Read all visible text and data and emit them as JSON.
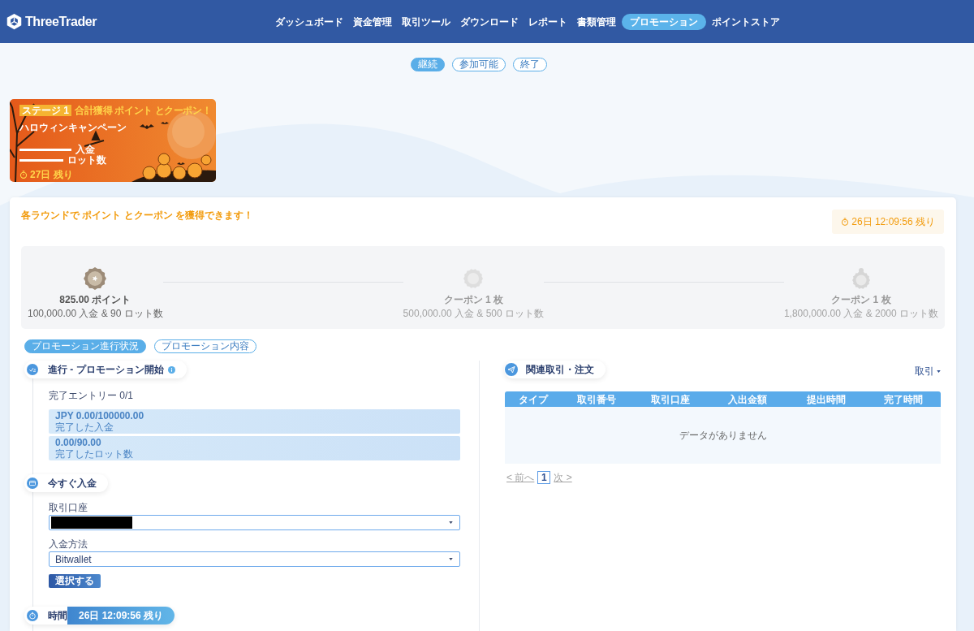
{
  "header": {
    "logo": "ThreeTrader",
    "nav": [
      {
        "label": "ダッシュボード",
        "selected": false
      },
      {
        "label": "資金管理",
        "selected": false
      },
      {
        "label": "取引ツール",
        "selected": false
      },
      {
        "label": "ダウンロード",
        "selected": false
      },
      {
        "label": "レポート",
        "selected": false
      },
      {
        "label": "書類管理",
        "selected": false
      },
      {
        "label": "プロモーション",
        "selected": true
      },
      {
        "label": "ポイントストア",
        "selected": false
      }
    ]
  },
  "status_filters": [
    {
      "label": "継続",
      "selected": true
    },
    {
      "label": "参加可能",
      "selected": false
    },
    {
      "label": "終了",
      "selected": false
    }
  ],
  "banner": {
    "stage": "ステージ 1",
    "headline": "合計獲得 ポイント とクーポン！",
    "title": "ハロウィンキャンペーン",
    "metrics": [
      "入金",
      "ロット数"
    ],
    "remaining": "27日 残り"
  },
  "promotion": {
    "intro": "各ラウンドで ポイント とクーポン を獲得できます！",
    "timer": "26日 12:09:56 残り",
    "stages": [
      {
        "kind": "seal",
        "reward": "825.00 ポイント",
        "requirement": "100,000.00 入金 & 90 ロット数",
        "active": true
      },
      {
        "kind": "coin",
        "reward": "クーポン 1 枚",
        "requirement": "500,000.00 入金 & 500 ロット数",
        "active": false
      },
      {
        "kind": "pendant",
        "reward": "クーポン 1 枚",
        "requirement": "1,800,000.00 入金 & 2000 ロット数",
        "active": false
      }
    ]
  },
  "tabs": [
    {
      "label": "プロモーション進行状況",
      "selected": true
    },
    {
      "label": "プロモーション内容",
      "selected": false
    }
  ],
  "steps": [
    {
      "kind": "progress",
      "title": "進行 - プロモーション開始",
      "entries": "完了エントリー 0/1",
      "bars": [
        {
          "value": "JPY 0.00/100000.00",
          "caption": "完了した入金"
        },
        {
          "value": "0.00/90.00",
          "caption": "完了したロット数"
        }
      ]
    },
    {
      "kind": "deposit",
      "title": "今すぐ入金",
      "fields": [
        {
          "label": "取引口座",
          "redacted": true
        },
        {
          "label": "入金方法",
          "value": "Bitwallet",
          "redacted": false
        }
      ],
      "submit": "選択する"
    },
    {
      "kind": "timer",
      "title": "時間",
      "countdown": "26日 12:09:56 残り"
    }
  ],
  "orders": {
    "title": "関連取引・注文",
    "filter": "取引",
    "columns": [
      "タイプ",
      "取引番号",
      "取引口座",
      "入出金額",
      "提出時間",
      "完了時間"
    ],
    "empty_text": "データがありません",
    "pagination": {
      "prev": {
        "label": "< 前へ",
        "disabled": true
      },
      "pages": [
        {
          "label": "1",
          "selected": true
        }
      ],
      "next": {
        "label": "次 >",
        "disabled": true
      }
    }
  }
}
